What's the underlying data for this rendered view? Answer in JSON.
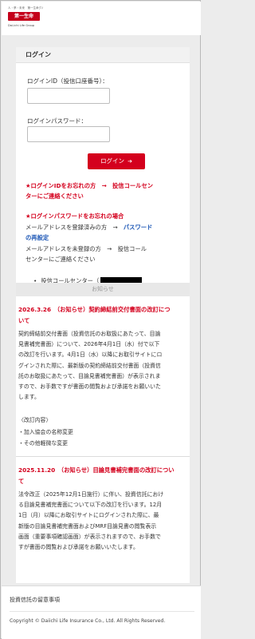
{
  "header": {
    "logo_top": "人・夢・未来　第一生命グループ",
    "logo_badge": "第一生命",
    "logo_sub": "Dai-ichi Life Group"
  },
  "login": {
    "title": "ログイン",
    "id_label": "ログインID（投信口座番号）：",
    "password_label": "ログインパスワード：",
    "id_value": "",
    "password_value": "",
    "button_label": "ログイン",
    "button_icon": "➔",
    "forgot_id": {
      "line1": "★ログインIDをお忘れの方　→　投信コールセン",
      "line2": "ターにご連絡ください"
    },
    "forgot_password": {
      "heading": "★ログインパスワードをお忘れの場合",
      "email_registered_prefix": "メールアドレスを登録済みの方　→　",
      "email_registered_link": "パスワード",
      "email_registered_link2": "の再設定",
      "email_unregistered_line1": "メールアドレスを未登録の方　→　投信コール",
      "email_unregistered_line2": "センターにご連絡ください"
    },
    "call_center_prefix": "投信コールセンター（",
    "call_center_bullet": "•"
  },
  "notices": {
    "heading": "お知らせ",
    "items": [
      {
        "title_line1": "2026.3.26　（お知らせ）契約締結前交付書面の改訂につ",
        "title_line2": "いて",
        "body_lines": [
          "契約締結前交付書面（投資信託のお取扱にあたって、目論",
          "見書補完書面）について、2026年4月1日（水）付で以下",
          "の改訂を行います。4月1日（水）以降にお取引サイトにロ",
          "グインされた際に、最新版の契約締結前交付書面（投資信",
          "託のお取扱にあたって、目論見書補完書面）が表示されま",
          "すので、お手数ですが書面の閲覧および承諾をお願いいた",
          "します。"
        ],
        "sub_heading": "〈改訂内容〉",
        "bullets": [
          "・加入協会の名称変更",
          "・その他軽微な変更"
        ]
      },
      {
        "title_line1": "2025.11.20　（お知らせ）目論見書補完書面の改訂につい",
        "title_line2": "て",
        "body_lines": [
          "法令改正（2025年12月1日施行）に伴い、投資信託におけ",
          "る目論見書補完書面について以下の改訂を行います。12月",
          "1日（月）以降にお取引サイトにログインされた際に、最",
          "新版の目論見書補完書面およびMRF目論見書の閲覧表示",
          "画面（重要事項確認画面）が表示されますので、お手数で",
          "すが書面の閲覧および承諾をお願いいたします。"
        ]
      }
    ]
  },
  "footer": {
    "link": "投資信託の留意事項",
    "copyright": "Copyright © Daiichi Life Insurance Co., Ltd. All Rights Reserved."
  },
  "colors": {
    "accent_red": "#d4001d",
    "link_blue": "#1a55b5",
    "background": "#ececec"
  }
}
